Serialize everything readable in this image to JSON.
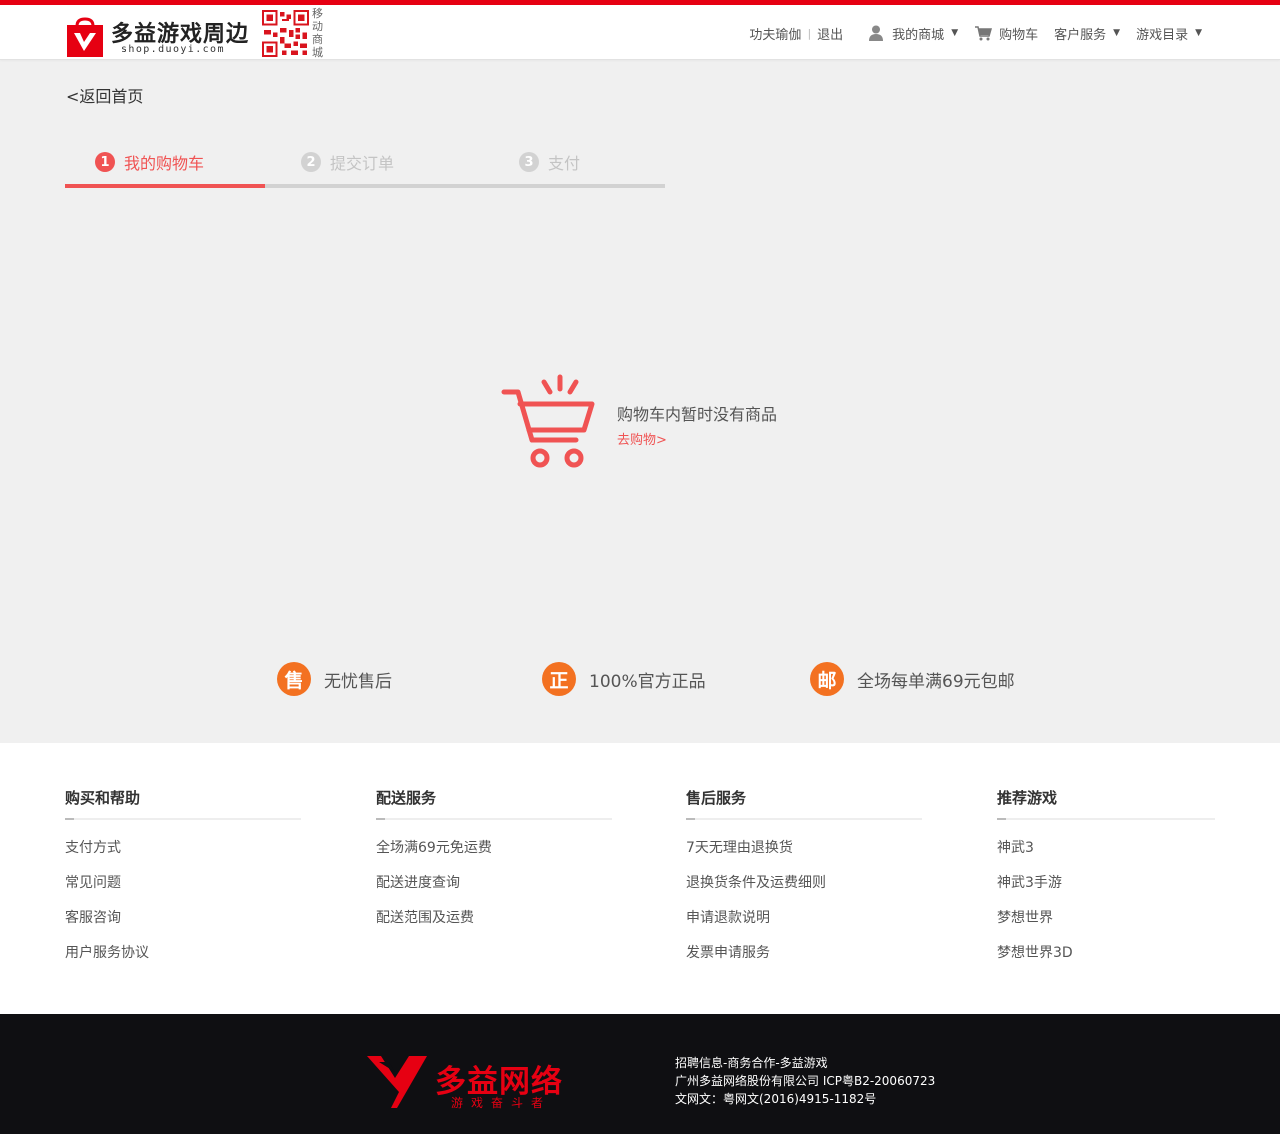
{
  "header": {
    "logo_text": "多益游戏周边",
    "logo_sub": "shop.duoyi.com",
    "qr_label": "移动商城",
    "username": "功夫瑜伽",
    "logout": "退出",
    "my_mall": "我的商城",
    "cart": "购物车",
    "customer_service": "客户服务",
    "game_catalog": "游戏目录"
  },
  "back_link": "<返回首页",
  "steps": [
    {
      "num": "1",
      "label": "我的购物车",
      "active": true
    },
    {
      "num": "2",
      "label": "提交订单",
      "active": false
    },
    {
      "num": "3",
      "label": "支付",
      "active": false
    }
  ],
  "empty_cart": {
    "message": "购物车内暂时没有商品",
    "link": "去购物>"
  },
  "guarantees": [
    {
      "badge": "售",
      "text": "无忧售后"
    },
    {
      "badge": "正",
      "text": "100%官方正品"
    },
    {
      "badge": "邮",
      "text": "全场每单满69元包邮"
    }
  ],
  "footer": {
    "columns": [
      {
        "title": "购买和帮助",
        "items": [
          "支付方式",
          "常见问题",
          "客服咨询",
          "用户服务协议"
        ]
      },
      {
        "title": "配送服务",
        "items": [
          "全场满69元免运费",
          "配送进度查询",
          "配送范围及运费"
        ]
      },
      {
        "title": "售后服务",
        "items": [
          "7天无理由退换货",
          "退换货条件及运费细则",
          "申请退款说明",
          "发票申请服务"
        ]
      },
      {
        "title": "推荐游戏",
        "items": [
          "神武3",
          "神武3手游",
          "梦想世界",
          "梦想世界3D"
        ]
      }
    ]
  },
  "bottom": {
    "logo_text": "多益网络",
    "logo_sub": "游戏奋斗者",
    "lines": [
      "招聘信息-商务合作-多益游戏",
      "广州多益网络股份有限公司 ICP粤B2-20060723",
      "文网文：粤网文(2016)4915-1182号"
    ]
  },
  "colors": {
    "brand_red": "#e60012",
    "accent": "#f05353",
    "badge_orange": "#f37121"
  }
}
